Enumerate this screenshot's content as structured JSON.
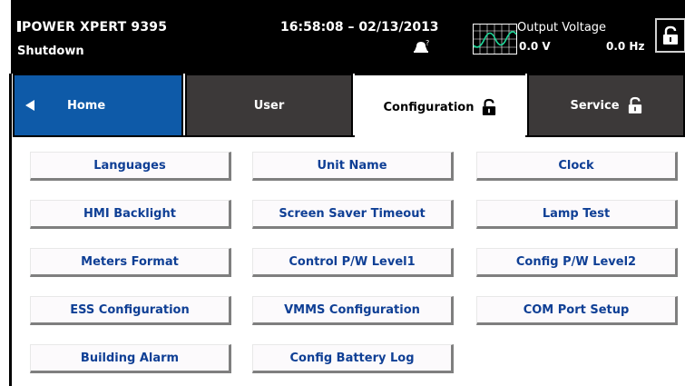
{
  "header": {
    "product_name": "POWER XPERT 9395",
    "status": "Shutdown",
    "datetime": "16:58:08 – 02/13/2013",
    "alarm_icon": "bell-with-question-icon",
    "waveform_icon": "sine-wave-grid-icon",
    "output_voltage_label": "Output Voltage",
    "output_volts": "0.0 V",
    "output_hz": "0.0 Hz",
    "lock_icon": "unlocked-padlock-icon"
  },
  "tabs": [
    {
      "label": "Home",
      "icon": "left-arrow-icon",
      "color": "#0e5aa8"
    },
    {
      "label": "User",
      "color": "#3c3939"
    },
    {
      "label": "Configuration",
      "icon": "unlocked-padlock-icon",
      "active": true
    },
    {
      "label": "Service",
      "icon": "unlocked-padlock-icon",
      "color": "#3c3939"
    }
  ],
  "buttons": [
    {
      "label": "Languages"
    },
    {
      "label": "Unit Name"
    },
    {
      "label": "Clock"
    },
    {
      "label": "HMI Backlight"
    },
    {
      "label": "Screen Saver Timeout"
    },
    {
      "label": "Lamp Test"
    },
    {
      "label": "Meters Format"
    },
    {
      "label": "Control P/W Level1"
    },
    {
      "label": "Config P/W Level2"
    },
    {
      "label": "ESS Configuration"
    },
    {
      "label": "VMMS Configuration"
    },
    {
      "label": "COM Port Setup"
    },
    {
      "label": "Building Alarm"
    },
    {
      "label": "Config Battery Log"
    }
  ],
  "colors": {
    "header_bg": "#000000",
    "home_tab": "#0e5aa8",
    "inactive_tab": "#3c3939",
    "button_text": "#0f3f95",
    "button_bg": "#fcfafc"
  }
}
